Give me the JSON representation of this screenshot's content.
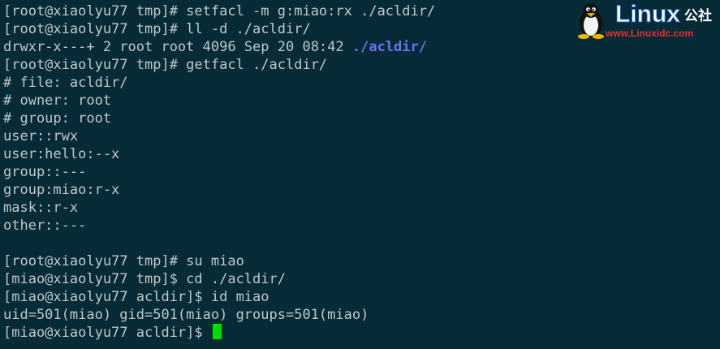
{
  "terminal": {
    "lines": [
      {
        "text": "[root@xiaolyu77 tmp]# setfacl -m g:miao:rx ./acldir/"
      },
      {
        "text": "[root@xiaolyu77 tmp]# ll -d ./acldir/"
      },
      {
        "prefix": "drwxr-x---+ 2 root root 4096 Sep 20 08:42 ",
        "highlight": "./acldir/"
      },
      {
        "text": "[root@xiaolyu77 tmp]# getfacl ./acldir/"
      },
      {
        "text": "# file: acldir/"
      },
      {
        "text": "# owner: root"
      },
      {
        "text": "# group: root"
      },
      {
        "text": "user::rwx"
      },
      {
        "text": "user:hello:--x"
      },
      {
        "text": "group::---"
      },
      {
        "text": "group:miao:r-x"
      },
      {
        "text": "mask::r-x"
      },
      {
        "text": "other::---"
      },
      {
        "text": ""
      },
      {
        "text": "[root@xiaolyu77 tmp]# su miao"
      },
      {
        "text": "[miao@xiaolyu77 tmp]$ cd ./acldir/"
      },
      {
        "text": "[miao@xiaolyu77 acldir]$ id miao"
      },
      {
        "text": "uid=501(miao) gid=501(miao) groups=501(miao)"
      },
      {
        "text": "[miao@xiaolyu77 acldir]$ "
      }
    ]
  },
  "watermark": {
    "brand": "Linux",
    "brand_cn": "公社",
    "url": "www.Linuxidc.com",
    "icon": "tux-penguin-icon"
  },
  "colors": {
    "background": "#062b36",
    "text": "#c0c8c9",
    "directory": "#6f6ff5",
    "cursor": "#00e000"
  }
}
